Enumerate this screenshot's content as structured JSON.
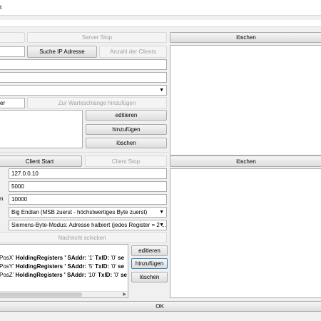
{
  "window": {
    "title_fragment": "t"
  },
  "server": {
    "stop_label": "Server Stop",
    "search_ip_label": "Suche IP Adresse",
    "client_count_label": "Anzahl der Clients",
    "log_clear_label": "löschen",
    "queue_field_value": "er",
    "queue_add_label": "Zur Warteschlange hinzufügen",
    "edit_label": "editieren",
    "add_label": "hinzufügen",
    "clear_label": "löschen"
  },
  "client": {
    "start_label": "Client Start",
    "stop_label": "Client Stop",
    "log_clear_label": "löschen",
    "ip_address": "127.0.0.10",
    "port": "5000",
    "field3_label_fragment": "n",
    "field3_value": "10000",
    "byte_order": "Big Endian (MSB zuerst - höchstwertiges Byte zuerst)",
    "siemens_mode": "Siemens-Byte-Modus: Adresse halbiert (jedes Register = 2 ...",
    "send_label": "Nachricht schicken",
    "edit_label": "editieren",
    "add_label": "hinzufügen",
    "clear_label": "löschen",
    "messages": [
      {
        "prefix": "PosX'",
        "type": "HoldingRegisters",
        "saddr_label": "' SAddr:",
        "saddr": "'1'",
        "txid_label": "TxID:",
        "txid": "'0'",
        "tail": "se"
      },
      {
        "prefix": "PosY'",
        "type": "HoldingRegisters",
        "saddr_label": "' SAddr:",
        "saddr": "'5'",
        "txid_label": "TxID:",
        "txid": "'0'",
        "tail": "se"
      },
      {
        "prefix": "PosZ'",
        "type": "HoldingRegisters",
        "saddr_label": "' SAddr:",
        "saddr": "'10'",
        "txid_label": "TxID:",
        "txid": "'0'",
        "tail": "se"
      }
    ]
  },
  "footer": {
    "ok_label": "OK"
  }
}
